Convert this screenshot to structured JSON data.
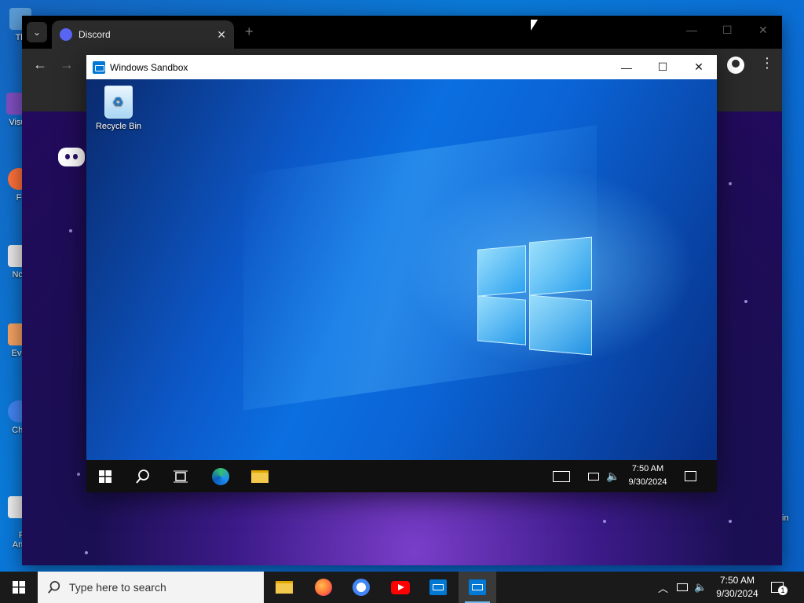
{
  "host_desktop": {
    "icons": [
      {
        "label": "Th"
      },
      {
        "label": "Visu"
      },
      {
        "label": "F"
      },
      {
        "label": "Not"
      },
      {
        "label": "Eve"
      },
      {
        "label": "Chr"
      },
      {
        "label": "F\nAnt"
      }
    ],
    "right_edge_label": "in"
  },
  "chrome": {
    "tab_title": "Discord",
    "tab_close": "✕",
    "new_tab": "+",
    "minimize": "—",
    "maximize": "☐",
    "close": "✕",
    "back": "←",
    "forward": "→",
    "menu": "⋮"
  },
  "sandbox": {
    "title": "Windows Sandbox",
    "minimize": "—",
    "maximize": "☐",
    "close": "✕",
    "desktop_icons": [
      {
        "label": "Recycle Bin"
      }
    ],
    "taskbar": {
      "time": "7:50 AM",
      "date": "9/30/2024"
    }
  },
  "taskbar": {
    "search_placeholder": "Type here to search",
    "time": "7:50 AM",
    "date": "9/30/2024",
    "notification_count": "1",
    "apps": [
      "file-explorer",
      "firefox",
      "chrome",
      "youtube",
      "windows-sandbox",
      "windows-sandbox-active"
    ]
  },
  "colors": {
    "desktop_blue": "#0b6ed6",
    "discord_blurple": "#5865f2",
    "taskbar": "#1a1a1a",
    "accent": "#76b9ed"
  }
}
